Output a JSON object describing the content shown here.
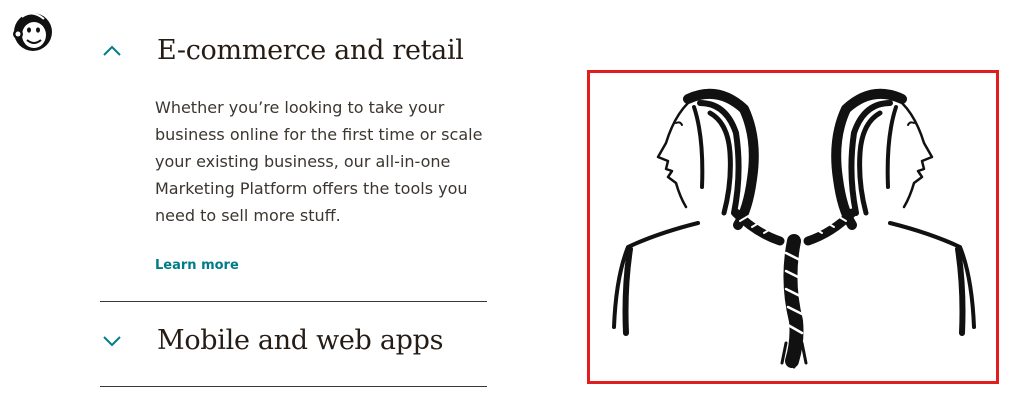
{
  "brand": {
    "logo_icon": "mailchimp-freddie-logo-icon"
  },
  "accordion": [
    {
      "title": "E-commerce and retail",
      "expanded": true,
      "chevron_icon": "chevron-up-icon",
      "body": "Whether you’re looking to take your business online for the first time or scale your existing business, our all-in-one Marketing Platform offers the tools you need to sell more stuff.",
      "link_label": "Learn more"
    },
    {
      "title": "Mobile and web apps",
      "expanded": false,
      "chevron_icon": "chevron-down-icon"
    }
  ],
  "illustration": {
    "icon": "braided-heads-illustration-icon",
    "highlight_color": "#e11d1d"
  },
  "colors": {
    "accent": "#007c89",
    "text": "#241c15",
    "rule": "#3c3630"
  }
}
